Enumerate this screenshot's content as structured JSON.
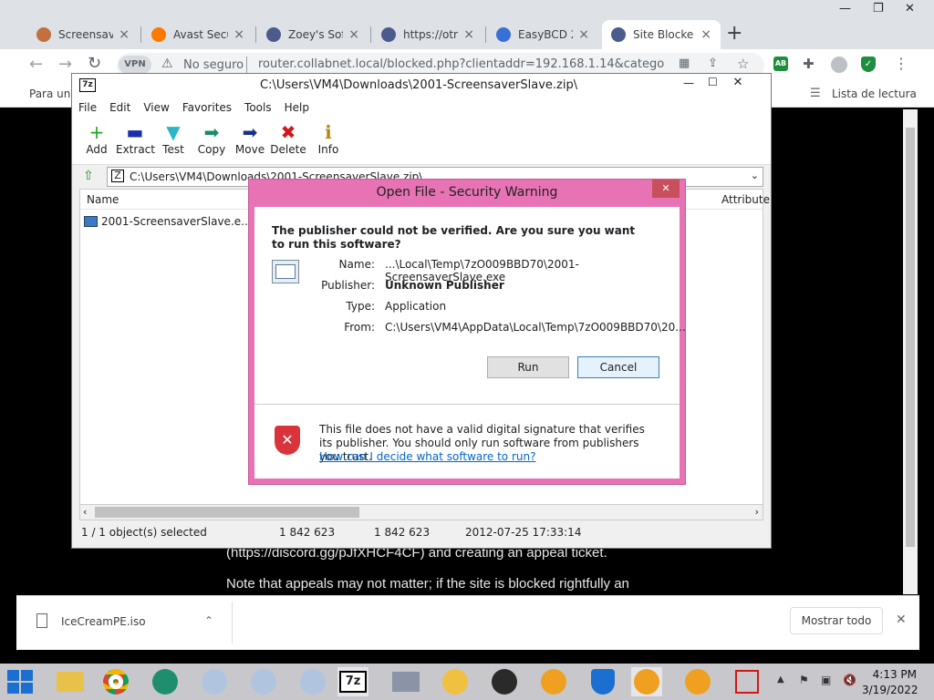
{
  "browser": {
    "tabs": [
      {
        "label": "Screensaver",
        "color": "#c2703d"
      },
      {
        "label": "Avast Secur",
        "color": "#ff7800"
      },
      {
        "label": "Zoey's Soft",
        "color": "#4a5b8c"
      },
      {
        "label": "https://otnc",
        "color": "#4a5b8c"
      },
      {
        "label": "EasyBCD 2.",
        "color": "#3a6fd8"
      },
      {
        "label": "Site Blocke",
        "color": "#4a5b8c",
        "active": true
      }
    ],
    "vpn": "VPN",
    "security": "No seguro",
    "url": "router.collabnet.local/blocked.php?clientaddr=192.168.1.14&category...",
    "bookmarks_left": "Para un a",
    "reading_list": "Lista de lectura",
    "page_line1": "(https://discord.gg/pJfXHCF4CF) and creating an appeal ticket.",
    "page_line2": "Note that appeals may not matter; if the site is blocked rightfully an",
    "download_file": "IceCreamPE.iso",
    "show_all": "Mostrar todo"
  },
  "zip": {
    "title": "C:\\Users\\VM4\\Downloads\\2001-ScreensaverSlave.zip\\",
    "menu": [
      "File",
      "Edit",
      "View",
      "Favorites",
      "Tools",
      "Help"
    ],
    "tools": [
      {
        "label": "Add",
        "icon": "+",
        "color": "#1fa31f"
      },
      {
        "label": "Extract",
        "icon": "▬",
        "color": "#1a2fa8"
      },
      {
        "label": "Test",
        "icon": "▼",
        "color": "#2bb6c8"
      },
      {
        "label": "Copy",
        "icon": "➡",
        "color": "#1a8a6a"
      },
      {
        "label": "Move",
        "icon": "➡",
        "color": "#1a2f8a"
      },
      {
        "label": "Delete",
        "icon": "✖",
        "color": "#d01818"
      },
      {
        "label": "Info",
        "icon": "ℹ",
        "color": "#b08a10"
      }
    ],
    "path": "C:\\Users\\VM4\\Downloads\\2001-ScreensaverSlave.zip\\",
    "col_name": "Name",
    "col_attr": "Attribute",
    "file": "2001-ScreensaverSlave.e...",
    "status": [
      "1 / 1 object(s) selected",
      "1 842 623",
      "1 842 623",
      "2012-07-25 17:33:14"
    ]
  },
  "dialog": {
    "title": "Open File - Security Warning",
    "question": "The publisher could not be verified.  Are you sure you want to run this software?",
    "name_label": "Name:",
    "name_value": "...\\Local\\Temp\\7zO009BBD70\\2001-ScreensaverSlave.exe",
    "publisher_label": "Publisher:",
    "publisher_value": "Unknown Publisher",
    "type_label": "Type:",
    "type_value": "Application",
    "from_label": "From:",
    "from_value": "C:\\Users\\VM4\\AppData\\Local\\Temp\\7zO009BBD70\\20...",
    "run": "Run",
    "cancel": "Cancel",
    "warning": "This file does not have a valid digital signature that verifies its publisher.  You should only run software from publishers you trust.",
    "link": "How can I decide what software to run?"
  },
  "taskbar": {
    "time": "4:13 PM",
    "date": "3/19/2022",
    "zip_icon": "7z"
  }
}
